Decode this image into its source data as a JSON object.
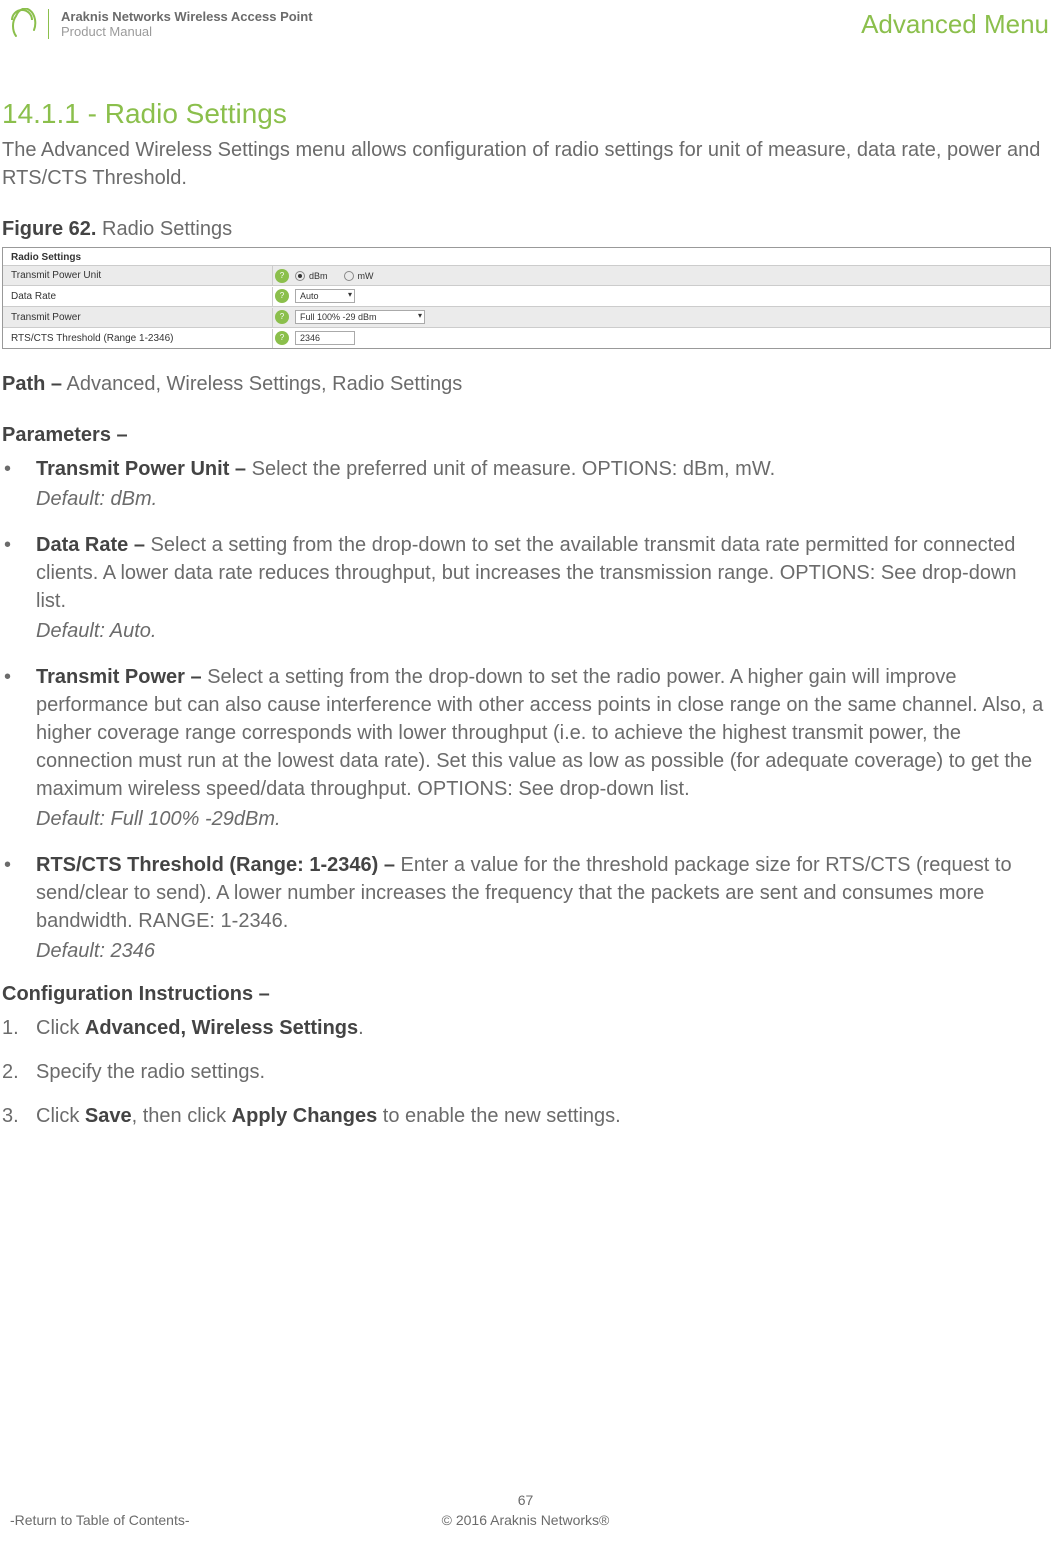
{
  "header": {
    "brand_line1": "Araknis Networks Wireless Access Point",
    "brand_line2": "Product Manual",
    "advanced_menu": "Advanced Menu"
  },
  "section": {
    "number_title": "14.1.1 - Radio Settings",
    "intro": "The Advanced Wireless Settings menu allows configuration of radio settings for unit of measure, data rate, power and RTS/CTS Threshold.",
    "figure_label": "Figure 62.",
    "figure_name": "Radio Settings",
    "path_label": "Path –",
    "path_value": "Advanced, Wireless Settings, Radio Settings",
    "params_heading": "Parameters –",
    "config_heading": "Configuration Instructions –"
  },
  "screenshot": {
    "title": "Radio Settings",
    "rows": [
      {
        "label": "Transmit Power Unit",
        "type": "radio",
        "options": [
          "dBm",
          "mW"
        ],
        "selected": "dBm"
      },
      {
        "label": "Data Rate",
        "type": "select",
        "value": "Auto"
      },
      {
        "label": "Transmit Power",
        "type": "select",
        "value": "Full 100% -29 dBm"
      },
      {
        "label": "RTS/CTS Threshold (Range 1-2346)",
        "type": "input",
        "value": "2346"
      }
    ]
  },
  "parameters": [
    {
      "term": "Transmit Power Unit –",
      "desc": "Select the preferred unit of measure. OPTIONS: dBm, mW.",
      "default": "Default: dBm."
    },
    {
      "term": "Data Rate –",
      "desc": "Select a setting from the drop-down to set the available transmit data rate permitted for connected clients. A lower data rate reduces throughput, but increases the transmission range. OPTIONS: See drop-down list.",
      "default": "Default: Auto."
    },
    {
      "term": "Transmit Power –",
      "desc": "Select a setting from the drop-down to set the radio power. A higher gain will improve performance but can also cause interference with other access points in close range on the same channel. Also, a higher coverage range corresponds with lower throughput (i.e. to achieve the highest transmit power, the connection must run at the lowest data rate). Set this value as low as possible (for adequate coverage) to get the maximum wireless speed/data throughput. OPTIONS: See drop-down list.",
      "default": "Default: Full 100% -29dBm."
    },
    {
      "term": "RTS/CTS Threshold (Range: 1-2346) –",
      "desc": "Enter a value for the threshold package size for RTS/CTS (request to send/clear to send). A lower number increases the frequency that the packets are sent and consumes more bandwidth. RANGE: 1-2346.",
      "default": "Default: 2346"
    }
  ],
  "steps": [
    {
      "num": "1.",
      "pre": "Click ",
      "b1": "Advanced, Wireless Settings",
      "post": "."
    },
    {
      "num": "2.",
      "pre": "Specify the radio settings.",
      "b1": "",
      "post": ""
    },
    {
      "num": "3.",
      "pre": "Click ",
      "b1": "Save",
      "mid": ", then click ",
      "b2": "Apply Changes",
      "post": " to enable the new settings."
    }
  ],
  "footer": {
    "page": "67",
    "left": "-Return to Table of Contents-",
    "center": "© 2016 Araknis Networks®"
  }
}
